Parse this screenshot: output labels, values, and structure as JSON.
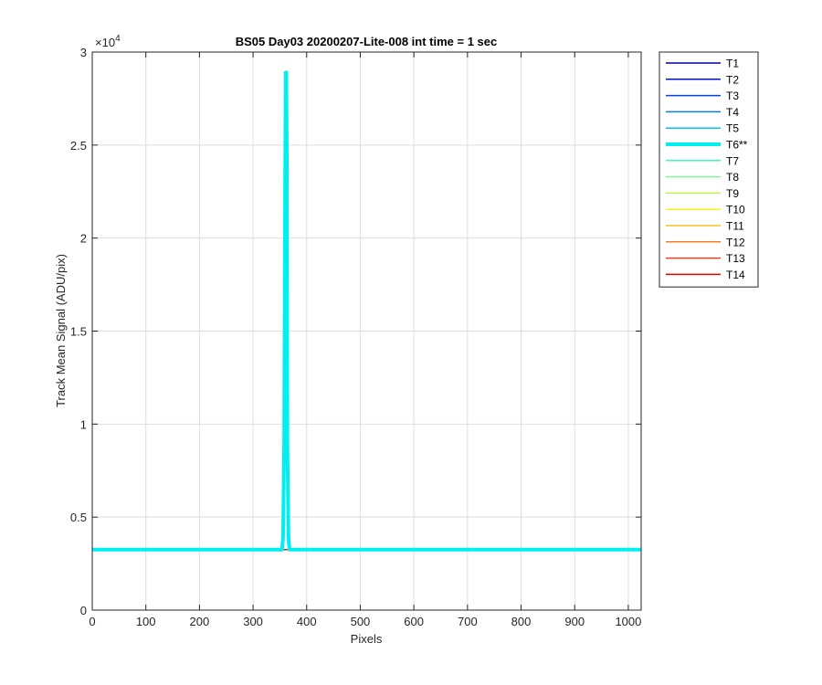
{
  "chart_data": {
    "type": "line",
    "title": "BS05 Day03 20200207-Lite-008 int time = 1 sec",
    "xlabel": "Pixels",
    "ylabel": "Track Mean Signal (ADU/pix)",
    "xlim": [
      0,
      1024
    ],
    "ylim": [
      0,
      30000
    ],
    "xticks": [
      0,
      100,
      200,
      300,
      400,
      500,
      600,
      700,
      800,
      900,
      1000
    ],
    "yticks": [
      0,
      5000,
      10000,
      15000,
      20000,
      25000,
      30000
    ],
    "ytick_labels": [
      "0",
      "0.5",
      "1",
      "1.5",
      "2",
      "2.5",
      "3"
    ],
    "y_exponent_base": "10",
    "y_exponent_power": "4",
    "y_exponent_prefix": "×",
    "grid": true,
    "legend_position": "outside-right",
    "baseline": 3250,
    "series": [
      {
        "name": "T1",
        "color": "#0000aa",
        "highlight": false
      },
      {
        "name": "T2",
        "color": "#0010d8",
        "highlight": false
      },
      {
        "name": "T3",
        "color": "#0040f0",
        "highlight": false
      },
      {
        "name": "T4",
        "color": "#0080f0",
        "highlight": false
      },
      {
        "name": "T5",
        "color": "#00bff5",
        "highlight": false
      },
      {
        "name": "T6**",
        "color": "#00f0f0",
        "highlight": true,
        "peak": {
          "x": [
            354,
            356,
            358,
            360,
            361,
            362,
            363,
            364,
            366,
            368
          ],
          "y": [
            3250,
            3900,
            9000,
            24000,
            28900,
            28900,
            24000,
            9000,
            3900,
            3250
          ]
        }
      },
      {
        "name": "T7",
        "color": "#40f5c8",
        "highlight": false
      },
      {
        "name": "T8",
        "color": "#80f5a0",
        "highlight": false
      },
      {
        "name": "T9",
        "color": "#c0f550",
        "highlight": false
      },
      {
        "name": "T10",
        "color": "#f5f020",
        "highlight": false
      },
      {
        "name": "T11",
        "color": "#f5c020",
        "highlight": false
      },
      {
        "name": "T12",
        "color": "#f58020",
        "highlight": false
      },
      {
        "name": "T13",
        "color": "#f54020",
        "highlight": false
      },
      {
        "name": "T14",
        "color": "#e00000",
        "highlight": false
      }
    ]
  }
}
